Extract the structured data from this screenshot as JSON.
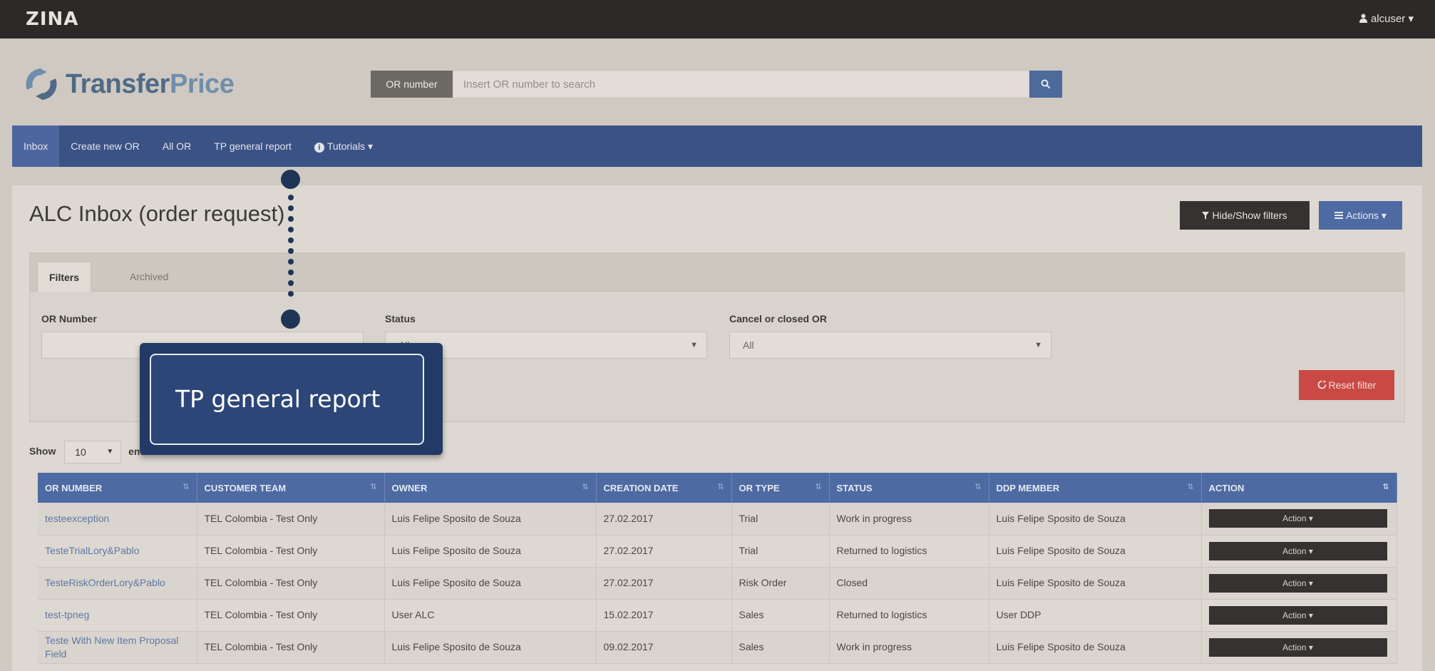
{
  "topbar": {
    "brand": "ZINA",
    "user": "alcuser ▾"
  },
  "logo": {
    "part1": "Transfer",
    "part2": "Price"
  },
  "search": {
    "label": "OR number",
    "placeholder": "Insert OR number to search"
  },
  "nav": {
    "items": [
      {
        "label": "Inbox"
      },
      {
        "label": "Create new OR"
      },
      {
        "label": "All OR"
      },
      {
        "label": "TP general report"
      },
      {
        "label": "Tutorials ▾"
      }
    ]
  },
  "page": {
    "title": "ALC Inbox (order request)",
    "hide_show_filters": "Hide/Show filters",
    "actions": "Actions ▾"
  },
  "filters": {
    "tabs": [
      "Filters",
      "Archived"
    ],
    "or_number_label": "OR Number",
    "status_label": "Status",
    "status_value": "All",
    "cancel_label": "Cancel or closed OR",
    "cancel_value": "All",
    "reset": "Reset filter"
  },
  "show": {
    "label": "Show",
    "value": "10",
    "tail": "entries"
  },
  "table": {
    "headers": [
      "OR NUMBER",
      "CUSTOMER TEAM",
      "OWNER",
      "CREATION DATE",
      "OR TYPE",
      "STATUS",
      "DDP MEMBER",
      "ACTION"
    ],
    "action_label": "Action ▾",
    "rows": [
      [
        "testeexception",
        "TEL Colombia - Test Only",
        "Luis Felipe Sposito de Souza",
        "27.02.2017",
        "Trial",
        "Work in progress",
        "Luis Felipe Sposito de Souza"
      ],
      [
        "TesteTrialLory&Pablo",
        "TEL Colombia - Test Only",
        "Luis Felipe Sposito de Souza",
        "27.02.2017",
        "Trial",
        "Returned to logistics",
        "Luis Felipe Sposito de Souza"
      ],
      [
        "TesteRiskOrderLory&Pablo",
        "TEL Colombia - Test Only",
        "Luis Felipe Sposito de Souza",
        "27.02.2017",
        "Risk Order",
        "Closed",
        "Luis Felipe Sposito de Souza"
      ],
      [
        "test-tpneg",
        "TEL Colombia - Test Only",
        "User ALC",
        "15.02.2017",
        "Sales",
        "Returned to logistics",
        "User DDP"
      ],
      [
        "Teste With New Item Proposal Field",
        "TEL Colombia - Test Only",
        "Luis Felipe Sposito de Souza",
        "09.02.2017",
        "Sales",
        "Work in progress",
        "Luis Felipe Sposito de Souza"
      ]
    ]
  },
  "callout": {
    "text": "TP general report"
  },
  "colors": {
    "nav": "#3b5285",
    "accent": "#4d6aa3",
    "danger": "#c94944",
    "callout": "#233a66"
  }
}
